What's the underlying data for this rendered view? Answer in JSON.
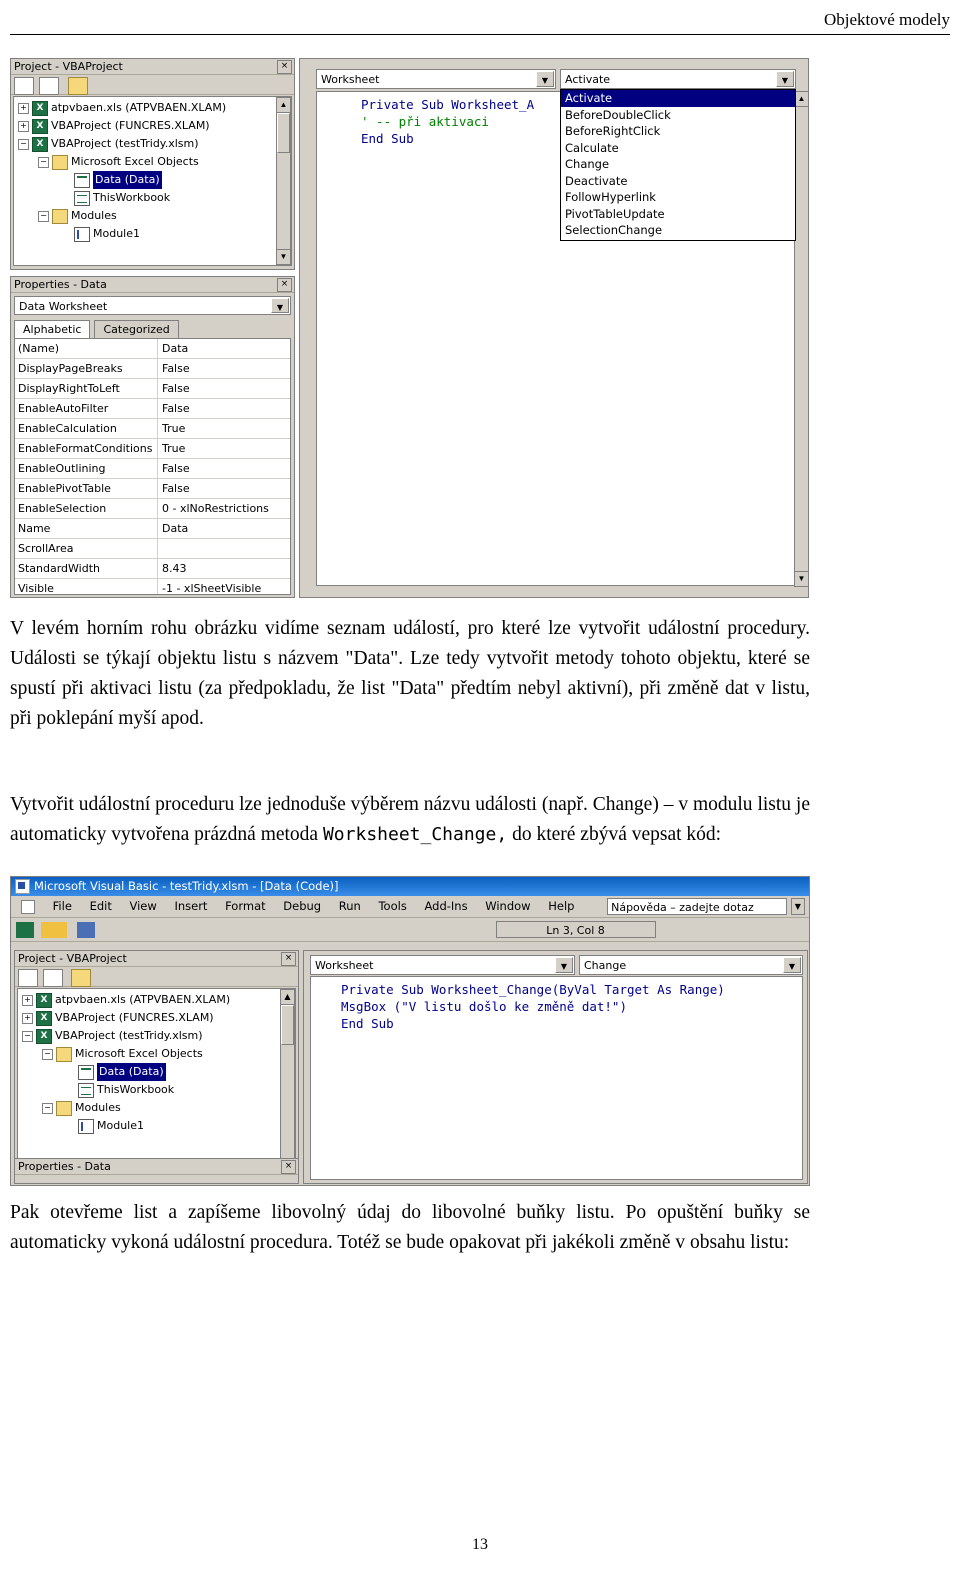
{
  "header": {
    "title": "Objektové modely"
  },
  "page_number": "13",
  "figure1": {
    "project_panel": {
      "title": "Project - VBAProject",
      "close_label": "×",
      "tree": [
        {
          "label": "atpvbaen.xls (ATPVBAEN.XLAM)",
          "expander": "+",
          "icon": "excel-icon",
          "indent": 0,
          "selected": false
        },
        {
          "label": "VBAProject (FUNCRES.XLAM)",
          "expander": "+",
          "icon": "excel-icon",
          "indent": 0,
          "selected": false
        },
        {
          "label": "VBAProject (testTridy.xlsm)",
          "expander": "−",
          "icon": "excel-icon",
          "indent": 0,
          "selected": false
        },
        {
          "label": "Microsoft Excel Objects",
          "expander": "−",
          "icon": "folder-icon",
          "indent": 1,
          "selected": false
        },
        {
          "label": "Data (Data)",
          "expander": "",
          "icon": "worksheet-icon",
          "indent": 2,
          "selected": true
        },
        {
          "label": "ThisWorkbook",
          "expander": "",
          "icon": "workbook-icon",
          "indent": 2,
          "selected": false
        },
        {
          "label": "Modules",
          "expander": "−",
          "icon": "folder-icon",
          "indent": 1,
          "selected": false
        },
        {
          "label": "Module1",
          "expander": "",
          "icon": "module-icon",
          "indent": 2,
          "selected": false
        }
      ]
    },
    "properties_panel": {
      "title": "Properties - Data",
      "close_label": "×",
      "object_combo": "Data Worksheet",
      "tabs": [
        "Alphabetic",
        "Categorized"
      ],
      "active_tab": "Alphabetic",
      "rows": [
        {
          "name": "(Name)",
          "value": "Data"
        },
        {
          "name": "DisplayPageBreaks",
          "value": "False"
        },
        {
          "name": "DisplayRightToLeft",
          "value": "False"
        },
        {
          "name": "EnableAutoFilter",
          "value": "False"
        },
        {
          "name": "EnableCalculation",
          "value": "True"
        },
        {
          "name": "EnableFormatConditions",
          "value": "True"
        },
        {
          "name": "EnableOutlining",
          "value": "False"
        },
        {
          "name": "EnablePivotTable",
          "value": "False"
        },
        {
          "name": "EnableSelection",
          "value": "0 - xlNoRestrictions"
        },
        {
          "name": "Name",
          "value": "Data"
        },
        {
          "name": "ScrollArea",
          "value": ""
        },
        {
          "name": "StandardWidth",
          "value": "8.43"
        },
        {
          "name": "Visible",
          "value": "-1 - xlSheetVisible"
        }
      ]
    },
    "code_window": {
      "object_combo": "Worksheet",
      "procedure_combo": "Activate",
      "code_lines": [
        {
          "text": "Private Sub Worksheet_A",
          "style": "code"
        },
        {
          "text": "' -- při aktivaci",
          "style": "comment"
        },
        {
          "text": "End Sub",
          "style": "code"
        }
      ],
      "dropdown_items": [
        {
          "label": "Activate",
          "highlighted": true
        },
        {
          "label": "BeforeDoubleClick",
          "highlighted": false
        },
        {
          "label": "BeforeRightClick",
          "highlighted": false
        },
        {
          "label": "Calculate",
          "highlighted": false
        },
        {
          "label": "Change",
          "highlighted": false
        },
        {
          "label": "Deactivate",
          "highlighted": false
        },
        {
          "label": "FollowHyperlink",
          "highlighted": false
        },
        {
          "label": "PivotTableUpdate",
          "highlighted": false
        },
        {
          "label": "SelectionChange",
          "highlighted": false
        }
      ]
    }
  },
  "text": {
    "p1": "V levém horním rohu obrázku vidíme seznam událostí, pro které lze vytvořit událostní procedury. Události se týkají objektu listu s názvem \"Data\". Lze tedy vytvořit metody tohoto objektu, které se spustí při aktivaci listu (za předpokladu, že list \"Data\" předtím nebyl aktivní), při změně dat v listu, při poklepání myší apod.",
    "p2_a": "Vytvořit událostní proceduru lze jednoduše výběrem názvu události (např. Change) – v modulu listu je automaticky vytvořena prázdná metoda ",
    "p2_mono": "Worksheet_Change,",
    "p2_b": " do které zbývá vepsat kód:",
    "p3": "Pak otevřeme list a zapíšeme libovolný údaj do libovolné buňky listu. Po opuštění buňky se automaticky vykoná událostní procedura. Totéž se bude opakovat při jakékoli změně v obsahu listu:"
  },
  "figure2": {
    "window_title": "Microsoft Visual Basic - testTridy.xlsm - [Data (Code)]",
    "menu": [
      "File",
      "Edit",
      "View",
      "Insert",
      "Format",
      "Debug",
      "Run",
      "Tools",
      "Add-Ins",
      "Window",
      "Help"
    ],
    "help_box": "Nápověda – zadejte dotaz",
    "status_position": "Ln 3, Col 8",
    "project_panel": {
      "title": "Project - VBAProject",
      "close_label": "×",
      "tree": [
        {
          "label": "atpvbaen.xls (ATPVBAEN.XLAM)",
          "expander": "+",
          "icon": "excel-icon",
          "indent": 0,
          "selected": false
        },
        {
          "label": "VBAProject (FUNCRES.XLAM)",
          "expander": "+",
          "icon": "excel-icon",
          "indent": 0,
          "selected": false
        },
        {
          "label": "VBAProject (testTridy.xlsm)",
          "expander": "−",
          "icon": "excel-icon",
          "indent": 0,
          "selected": false
        },
        {
          "label": "Microsoft Excel Objects",
          "expander": "−",
          "icon": "folder-icon",
          "indent": 1,
          "selected": false
        },
        {
          "label": "Data (Data)",
          "expander": "",
          "icon": "worksheet-icon",
          "indent": 2,
          "selected": true
        },
        {
          "label": "ThisWorkbook",
          "expander": "",
          "icon": "workbook-icon",
          "indent": 2,
          "selected": false
        },
        {
          "label": "Modules",
          "expander": "−",
          "icon": "folder-icon",
          "indent": 1,
          "selected": false
        },
        {
          "label": "Module1",
          "expander": "",
          "icon": "module-icon",
          "indent": 2,
          "selected": false
        }
      ]
    },
    "properties_panel": {
      "title": "Properties - Data",
      "close_label": "×"
    },
    "code_window": {
      "object_combo": "Worksheet",
      "procedure_combo": "Change",
      "code_lines": [
        {
          "text": "Private Sub Worksheet_Change(ByVal Target As Range)",
          "style": "code"
        },
        {
          "text": "    MsgBox (\"V listu došlo ke změně dat!\")",
          "style": "code"
        },
        {
          "text": "End Sub",
          "style": "code"
        }
      ]
    }
  }
}
